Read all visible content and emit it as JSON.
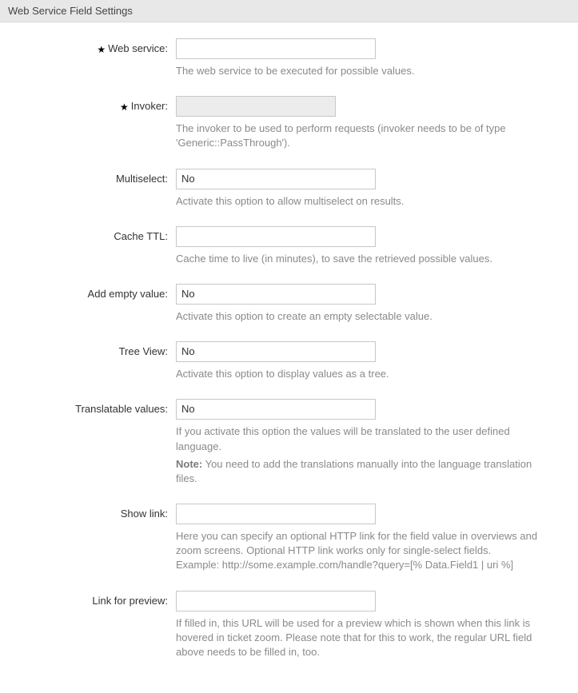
{
  "panel": {
    "title": "Web Service Field Settings"
  },
  "fields": {
    "webservice": {
      "label": "Web service:",
      "value": "",
      "help": "The web service to be executed for possible values.",
      "required": true
    },
    "invoker": {
      "label": "Invoker:",
      "value": "",
      "help": "The invoker to be used to perform requests (invoker needs to be of type 'Generic::PassThrough').",
      "required": true
    },
    "multiselect": {
      "label": "Multiselect:",
      "value": "No",
      "help": "Activate this option to allow multiselect on results."
    },
    "cachettl": {
      "label": "Cache TTL:",
      "value": "",
      "help": "Cache time to live (in minutes), to save the retrieved possible values."
    },
    "addempty": {
      "label": "Add empty value:",
      "value": "No",
      "help": "Activate this option to create an empty selectable value."
    },
    "treeview": {
      "label": "Tree View:",
      "value": "No",
      "help": "Activate this option to display values as a tree."
    },
    "translatable": {
      "label": "Translatable values:",
      "value": "No",
      "help": "If you activate this option the values will be translated to the user defined language.",
      "noteLabel": "Note:",
      "noteText": " You need to add the translations manually into the language translation files."
    },
    "showlink": {
      "label": "Show link:",
      "value": "",
      "help1": "Here you can specify an optional HTTP link for the field value in overviews and zoom screens. Optional HTTP link works only for single-select fields.",
      "help2": "Example: http://some.example.com/handle?query=[% Data.Field1 | uri %]"
    },
    "linkpreview": {
      "label": "Link for preview:",
      "value": "",
      "help": "If filled in, this URL will be used for a preview which is shown when this link is hovered in ticket zoom. Please note that for this to work, the regular URL field above needs to be filled in, too."
    }
  }
}
